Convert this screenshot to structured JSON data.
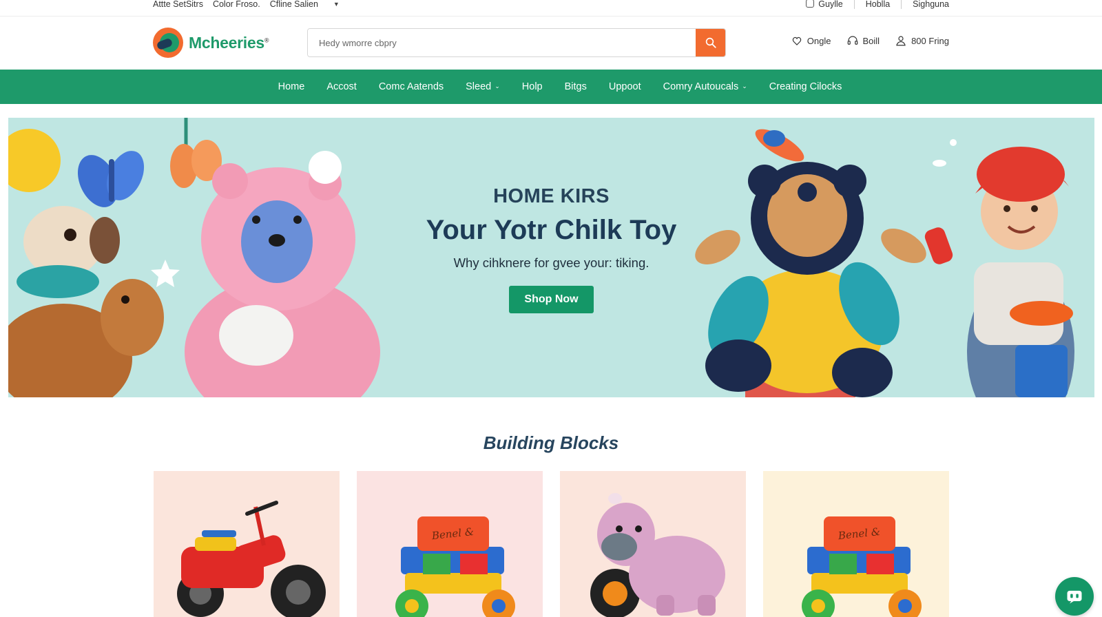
{
  "utility_bar": {
    "left_links": [
      "Attte SetSitrs",
      "Color Froso.",
      "Cfline Salien"
    ],
    "right_links": [
      "Guylle",
      "Hoblla",
      "Sighguna"
    ]
  },
  "header": {
    "brand": "Mcheeries",
    "brand_mark": "®",
    "search_placeholder": "Hedy wmorre cbpry",
    "actions": [
      {
        "label": "Ongle",
        "icon": "wish-icon"
      },
      {
        "label": "Boill",
        "icon": "headset-icon"
      },
      {
        "label": "800 Fring",
        "icon": "user-icon"
      }
    ]
  },
  "nav": {
    "items": [
      {
        "label": "Home",
        "dropdown": false
      },
      {
        "label": "Accost",
        "dropdown": false
      },
      {
        "label": "Comc Aatends",
        "dropdown": false
      },
      {
        "label": "Sleed",
        "dropdown": true
      },
      {
        "label": "Holp",
        "dropdown": false
      },
      {
        "label": "Bitgs",
        "dropdown": false
      },
      {
        "label": "Uppoot",
        "dropdown": false
      },
      {
        "label": "Comry Autoucals",
        "dropdown": true
      },
      {
        "label": "Creating Cilocks",
        "dropdown": false
      }
    ]
  },
  "hero": {
    "eyebrow": "HOME KIRS",
    "title": "Your Yotr Chilk Toy",
    "subtitle": "Why cihknere for gvee your: tiking.",
    "cta": "Shop Now"
  },
  "section": {
    "title": "Building Blocks"
  },
  "products": [
    {
      "name": "red-ride-on-bike",
      "block_text": ""
    },
    {
      "name": "building-block-vehicle",
      "block_text": "Benel &"
    },
    {
      "name": "plush-cow-on-bike",
      "block_text": ""
    },
    {
      "name": "building-block-vehicle-2",
      "block_text": "Benel &"
    }
  ],
  "colors": {
    "brand_green": "#1e9a6a",
    "accent_orange": "#f26b2f",
    "hero_bg": "#bfe6e2",
    "heading_navy": "#1d3b57"
  }
}
